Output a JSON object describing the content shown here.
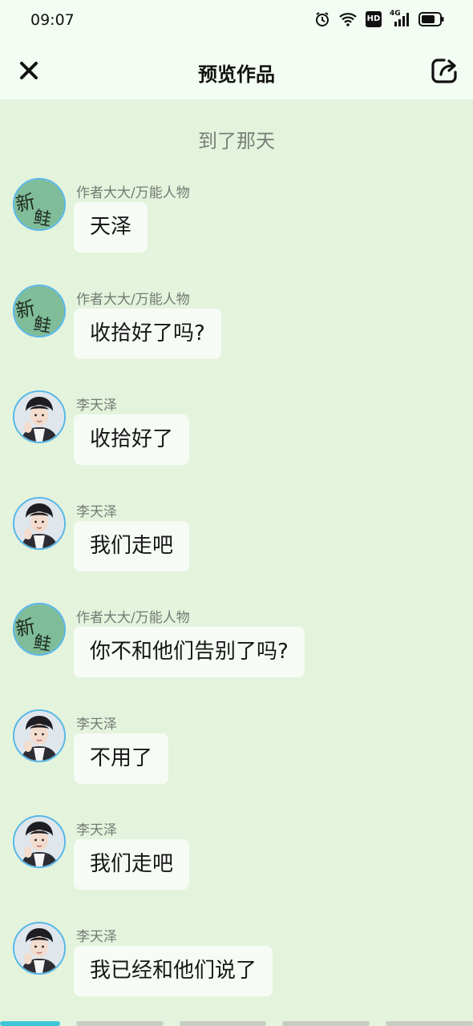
{
  "status_bar": {
    "time": "09:07",
    "icons": [
      "alarm-icon",
      "wifi-icon",
      "hd-icon",
      "4g-signal-icon",
      "battery-icon"
    ],
    "hd_text": "HD",
    "network_text": "4G"
  },
  "header": {
    "title": "预览作品",
    "close_icon": "close-icon",
    "share_icon": "share-icon"
  },
  "chat": {
    "chapter_title": "到了那天",
    "messages": [
      {
        "sender": "作者大大/万能人物",
        "text": "天泽",
        "avatar": "author-avatar"
      },
      {
        "sender": "作者大大/万能人物",
        "text": "收拾好了吗?",
        "avatar": "author-avatar"
      },
      {
        "sender": "李天泽",
        "text": "收拾好了",
        "avatar": "character-avatar"
      },
      {
        "sender": "李天泽",
        "text": "我们走吧",
        "avatar": "character-avatar"
      },
      {
        "sender": "作者大大/万能人物",
        "text": "你不和他们告别了吗?",
        "avatar": "author-avatar"
      },
      {
        "sender": "李天泽",
        "text": "不用了",
        "avatar": "character-avatar"
      },
      {
        "sender": "李天泽",
        "text": "我们走吧",
        "avatar": "character-avatar"
      },
      {
        "sender": "李天泽",
        "text": "我已经和他们说了",
        "avatar": "character-avatar"
      }
    ]
  },
  "progress": {
    "segments": 5,
    "active_segment": 1,
    "colors": {
      "active": "#3ec6d8",
      "inactive": "#c7cdc5"
    }
  },
  "colors": {
    "background": "#e4f3dc",
    "header_bg": "#f3fdf3",
    "bubble_bg": "#f6fcf5",
    "avatar_border": "#57b7e8"
  }
}
